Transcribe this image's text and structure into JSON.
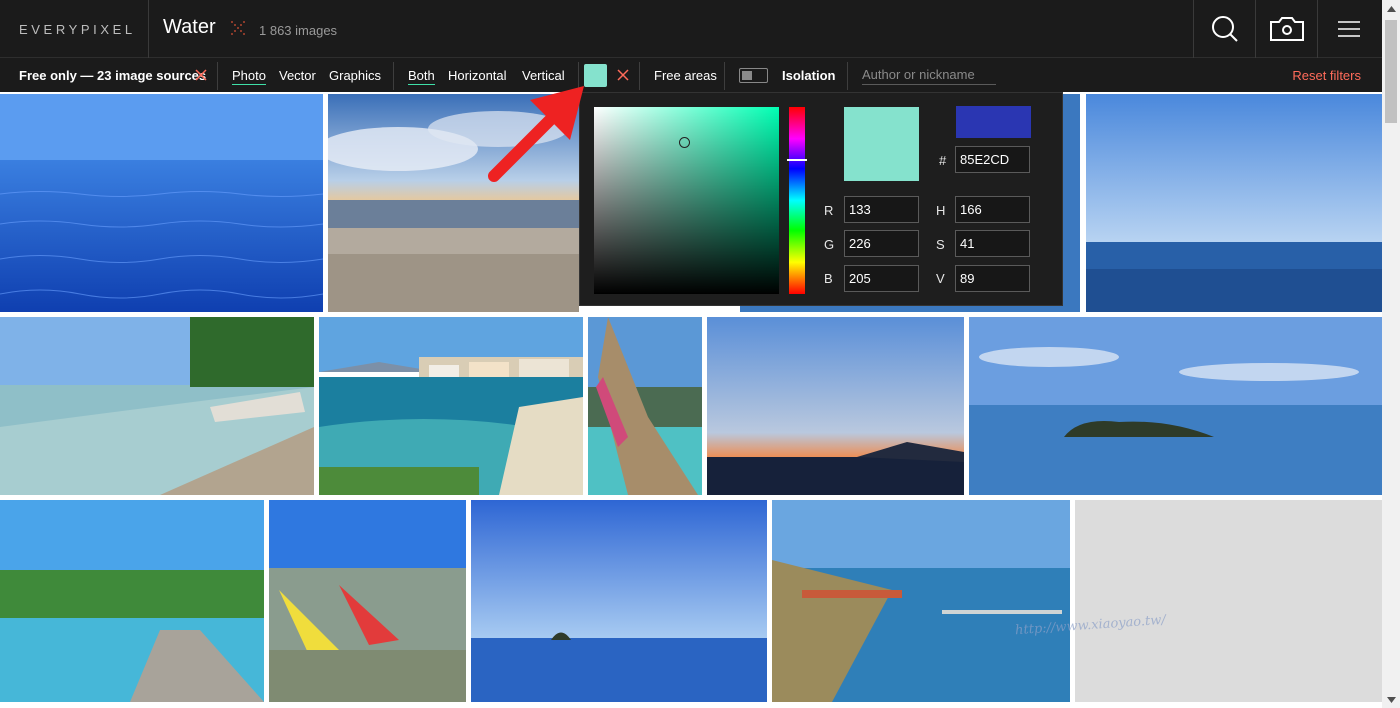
{
  "header": {
    "logo": "EVERYPIXEL",
    "query": "Water",
    "result_count": "1 863 images",
    "icons": [
      "search-icon",
      "camera-icon",
      "menu-icon"
    ]
  },
  "filters": {
    "free_only": "Free only — 23 image sources",
    "types": [
      "Photo",
      "Vector",
      "Graphics"
    ],
    "active_type": "Photo",
    "orientations": [
      "Both",
      "Horizontal",
      "Vertical"
    ],
    "active_orientation": "Both",
    "selected_color": "#85E2CD",
    "free_areas": "Free areas",
    "isolation": "Isolation",
    "author_placeholder": "Author or nickname",
    "reset": "Reset filters"
  },
  "color_picker": {
    "hex_symbol": "#",
    "hex": "85E2CD",
    "new_color": "#85e2cd",
    "previous_color": "#2a36b2",
    "rgb": {
      "R": "133",
      "G": "226",
      "B": "205"
    },
    "hsv": {
      "H": "166",
      "S": "41",
      "V": "89"
    }
  },
  "photos": [
    "blue ocean surface",
    "beach at sunset with clouds",
    "hidden photo behind picker",
    "clear sky over sea",
    "beach with driftwood log",
    "coastal village bay",
    "longtail boat bow",
    "sunset over bridge",
    "island in calm sea",
    "palm beach with pier",
    "pedal boats on beach",
    "small rock island",
    "marina aerial view",
    "loading placeholder"
  ],
  "colors": {
    "header_bg": "#1b1b1b",
    "active_underline": "#3fe0a8",
    "reset_color": "#ff6b5a",
    "arrow_color": "#ee2222"
  },
  "watermark": "http://www.xiaoyao.tw/"
}
